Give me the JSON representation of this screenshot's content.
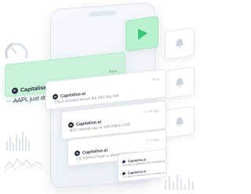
{
  "featured_notification": {
    "brand": "Capitalise.ai",
    "message": "AAPL just dropped 2% since market open",
    "time": "Now"
  },
  "notifications": [
    {
      "brand": "Capitalise.ai",
      "message": "TSLA crossed above the 200 day MA",
      "time": "Now"
    },
    {
      "brand": "Capitalise.ai",
      "message": "BTC market cap at 600 billion USD",
      "time": "5 min ago"
    },
    {
      "brand": "Capitalise.ai",
      "message": "US Interest Rate is above forecast",
      "time": "1 hr ago"
    },
    {
      "brand": "Capitalise.ai",
      "message": "You have a notification from Capitalise.ai",
      "time": ""
    },
    {
      "brand": "Capitalise.ai",
      "message": "You have a notification from Capitalise.ai",
      "time": ""
    }
  ],
  "tiles": [
    {
      "icon": "play-icon"
    },
    {
      "icon": "bell-icon"
    },
    {
      "icon": "bell-icon"
    },
    {
      "icon": "bell-icon"
    }
  ],
  "colors": {
    "accent_green": "#3fcf7f",
    "featured_bg": "#c6f2d6",
    "text_dark": "#1e2530",
    "text_muted": "#8a909b"
  }
}
